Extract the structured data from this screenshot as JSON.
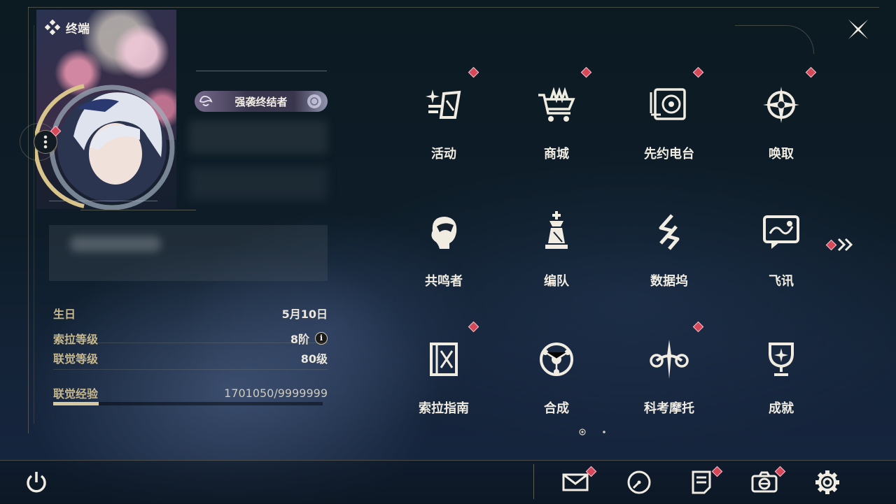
{
  "terminal": {
    "title": "终端"
  },
  "profile": {
    "title_badge": "强袭终结者",
    "stats": {
      "birthday_label": "生日",
      "birthday_value": "5月10日",
      "sola_label": "索拉等级",
      "sola_value": "8阶",
      "union_label": "联觉等级",
      "union_value": "80级",
      "exp_label": "联觉经验",
      "exp_value": "1701050/9999999",
      "exp_progress": 0.17
    }
  },
  "grid": [
    {
      "label": "活动",
      "icon": "sparkle-icon",
      "badge": true
    },
    {
      "label": "商城",
      "icon": "shop-cart-icon",
      "badge": true
    },
    {
      "label": "先约电台",
      "icon": "radio-icon",
      "badge": true
    },
    {
      "label": "唤取",
      "icon": "compass-star-icon",
      "badge": true
    },
    {
      "label": "共鸣者",
      "icon": "resonator-head-icon",
      "badge": false
    },
    {
      "label": "编队",
      "icon": "chess-piece-icon",
      "badge": false
    },
    {
      "label": "数据坞",
      "icon": "data-dock-icon",
      "badge": false
    },
    {
      "label": "飞讯",
      "icon": "message-icon",
      "badge": false
    },
    {
      "label": "索拉指南",
      "icon": "guide-book-icon",
      "badge": true
    },
    {
      "label": "合成",
      "icon": "synthesis-icon",
      "badge": false
    },
    {
      "label": "科考摩托",
      "icon": "motorbike-icon",
      "badge": true
    },
    {
      "label": "成就",
      "icon": "trophy-icon",
      "badge": false
    }
  ],
  "colors": {
    "accent_gold": "#c8b88c",
    "badge_red": "#d6475a"
  }
}
